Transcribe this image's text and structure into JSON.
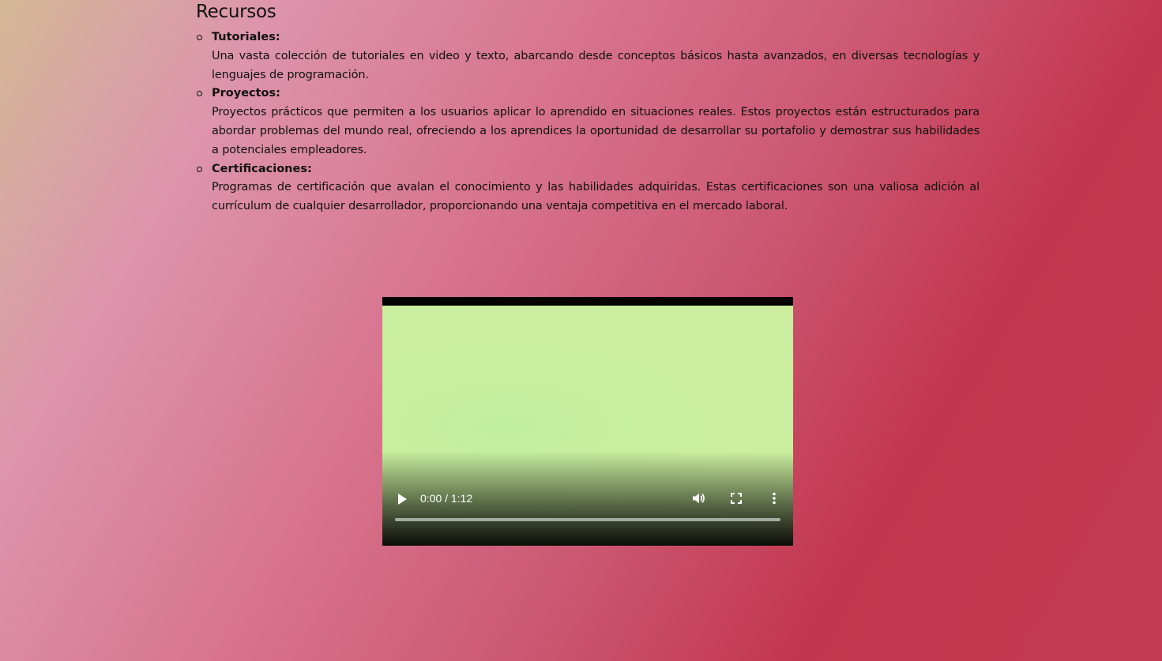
{
  "section": {
    "title": "Recursos",
    "items": [
      {
        "title": "Tutoriales:",
        "description": "Una vasta colección de tutoriales en video y texto, abarcando desde conceptos básicos hasta avanzados, en diversas tecnologías y lenguajes de programación."
      },
      {
        "title": "Proyectos:",
        "description": "Proyectos prácticos que permiten a los usuarios aplicar lo aprendido en situaciones reales. Estos proyectos están estructurados para abordar problemas del mundo real, ofreciendo a los aprendices la oportunidad de desarrollar su portafolio y demostrar sus habilidades a potenciales empleadores."
      },
      {
        "title": "Certificaciones:",
        "description": "Programas de certificación que avalan el conocimiento y las habilidades adquiridas. Estas certificaciones son una valiosa adición al currículum de cualquier desarrollador, proporcionando una ventaja competitiva en el mercado laboral."
      }
    ]
  },
  "video": {
    "time_display": "0:00 / 1:12",
    "progress": 0,
    "icons": {
      "play": "play-icon",
      "volume": "volume-icon",
      "fullscreen": "fullscreen-icon",
      "more": "more-options-icon"
    }
  },
  "colors": {
    "background_start": "#d3b896",
    "background_mid": "#d8758f",
    "background_end": "#c2374d",
    "video_poster": "#c8ef9e"
  }
}
